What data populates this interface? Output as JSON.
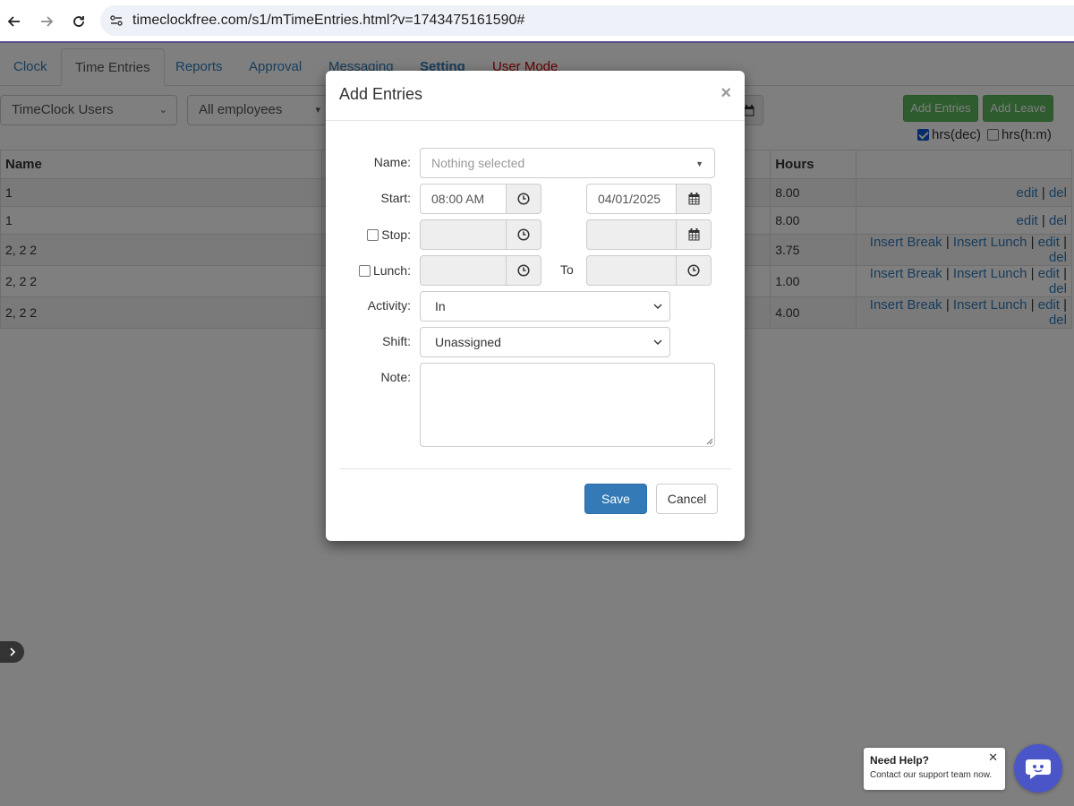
{
  "browser": {
    "url": "timeclockfree.com/s1/mTimeEntries.html?v=1743475161590#"
  },
  "tabs": [
    {
      "label": "Clock"
    },
    {
      "label": "Time Entries"
    },
    {
      "label": "Reports"
    },
    {
      "label": "Approval"
    },
    {
      "label": "Messaging"
    },
    {
      "label": "Setting"
    },
    {
      "label": "User Mode"
    }
  ],
  "filters": {
    "group": "TimeClock Users",
    "employees": "All employees"
  },
  "toolbar": {
    "add_entries": "Add Entries",
    "add_leave": "Add Leave",
    "hrs_dec": "hrs(dec)",
    "hrs_hm": "hrs(h:m)"
  },
  "table": {
    "headers": {
      "name": "Name",
      "hours": "Hours"
    },
    "rows": [
      {
        "name": "1",
        "hours": "8.00",
        "insert_break": "",
        "insert_lunch": "",
        "edit": "edit",
        "del": "del"
      },
      {
        "name": "1",
        "hours": "8.00",
        "insert_break": "",
        "insert_lunch": "",
        "edit": "edit",
        "del": "del"
      },
      {
        "name": "2, 2 2",
        "hours": "3.75",
        "insert_break": "Insert Break",
        "insert_lunch": "Insert Lunch",
        "edit": "edit",
        "del": "del"
      },
      {
        "name": "2, 2 2",
        "hours": "1.00",
        "insert_break": "Insert Break",
        "insert_lunch": "Insert Lunch",
        "edit": "edit",
        "del": "del"
      },
      {
        "name": "2, 2 2",
        "hours": "4.00",
        "insert_break": "Insert Break",
        "insert_lunch": "Insert Lunch",
        "edit": "edit",
        "del": "del"
      }
    ]
  },
  "modal": {
    "title": "Add Entries",
    "close": "×",
    "name_label": "Name:",
    "name_placeholder": "Nothing selected",
    "start_label": "Start:",
    "start_time": "08:00 AM",
    "start_date": "04/01/2025",
    "stop_label": "Stop:",
    "lunch_label": "Lunch:",
    "to_label": "To",
    "activity_label": "Activity:",
    "activity_value": "In",
    "shift_label": "Shift:",
    "shift_value": "Unassigned",
    "note_label": "Note:",
    "save": "Save",
    "cancel": "Cancel"
  },
  "help": {
    "title": "Need Help?",
    "subtitle": "Contact our support team now.",
    "close": "✕"
  },
  "colors": {
    "link": "#337ab7",
    "primary": "#337ab7",
    "success": "#5cb85c",
    "danger": "#cc0000",
    "chat": "#4a55c8"
  }
}
